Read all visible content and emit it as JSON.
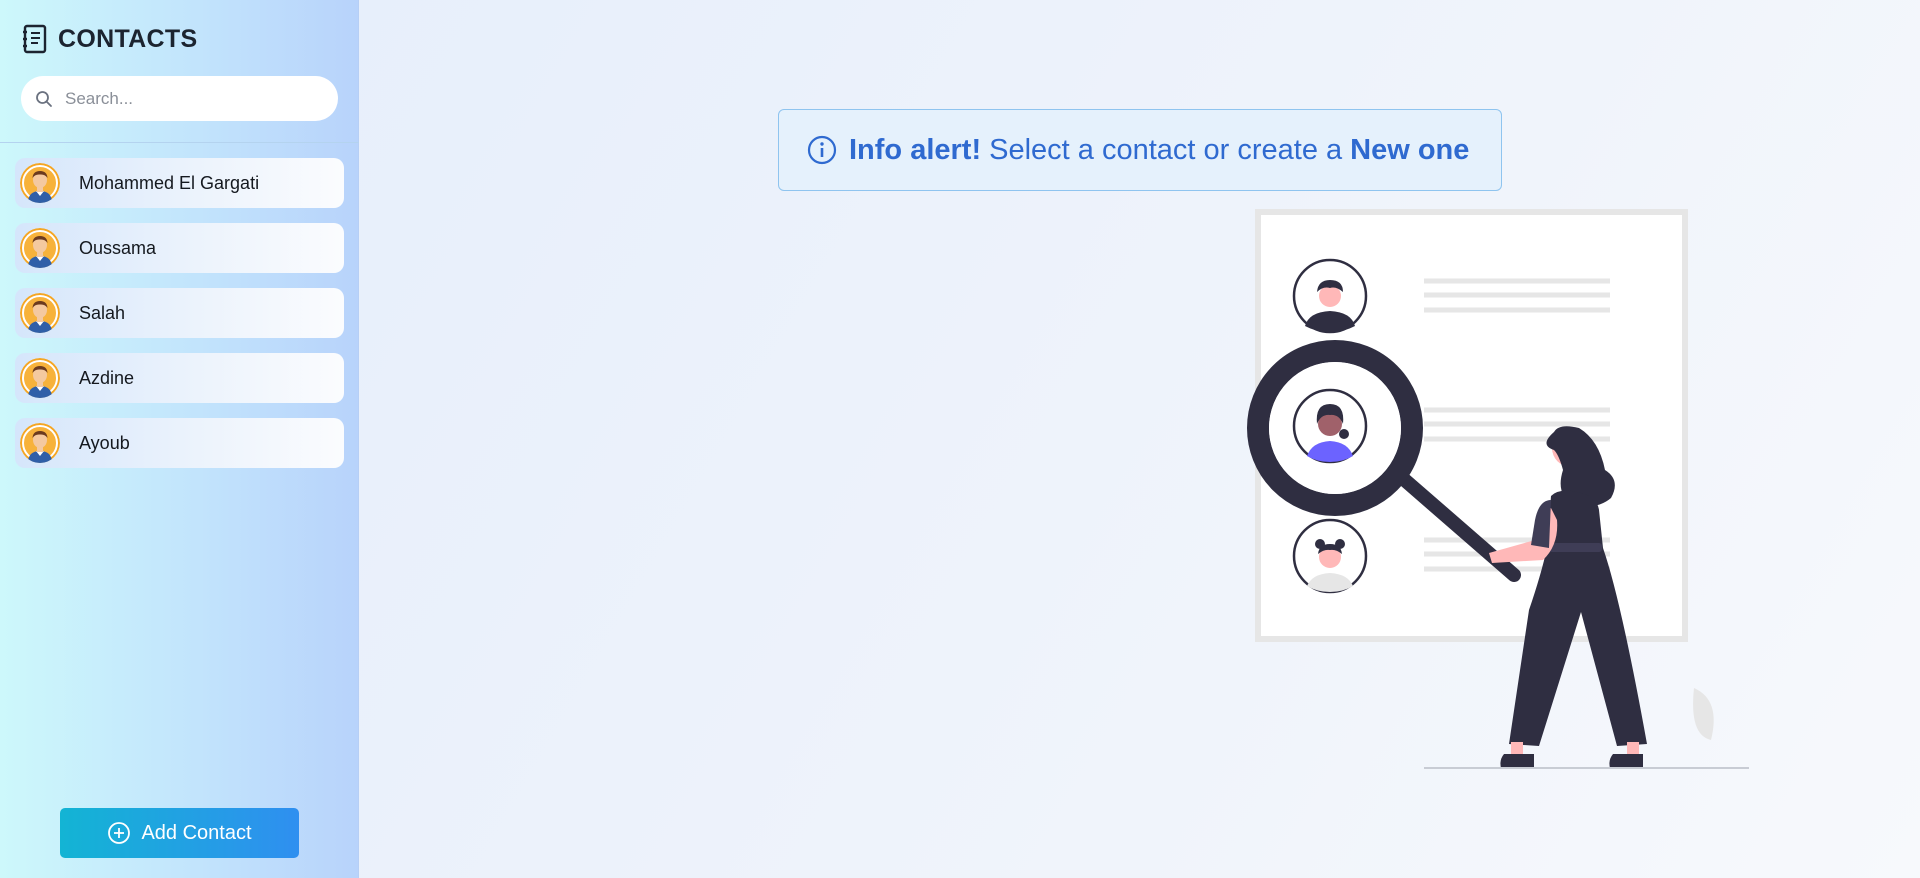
{
  "sidebar": {
    "title": "CONTACTS",
    "title_icon": "contact-book-icon",
    "search": {
      "placeholder": "Search...",
      "value": "",
      "icon": "search-icon"
    },
    "contacts": [
      {
        "name": "Mohammed El Gargati"
      },
      {
        "name": "Oussama"
      },
      {
        "name": "Salah"
      },
      {
        "name": "Azdine"
      },
      {
        "name": "Ayoub"
      }
    ],
    "add_button": {
      "label": "Add Contact",
      "icon": "plus-circle-icon"
    }
  },
  "main": {
    "alert": {
      "icon": "info-icon",
      "strong": "Info alert!",
      "message": "Select a contact or create a",
      "link": "New one"
    },
    "illustration": "search-contacts-illustration"
  },
  "colors": {
    "accent": "#2f6ad0",
    "button_start": "#13b4d4",
    "button_end": "#2f8ff0",
    "avatar_bg": "#f5a623"
  }
}
